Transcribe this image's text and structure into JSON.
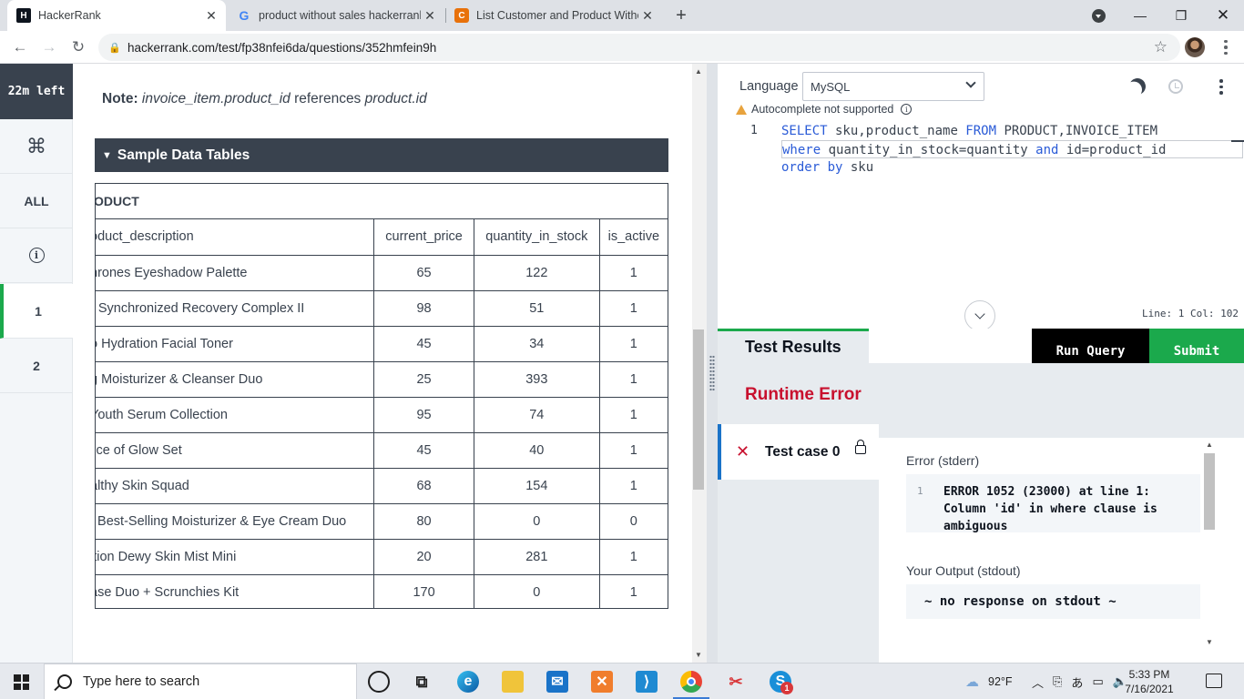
{
  "browser": {
    "tabs": [
      {
        "title": "HackerRank",
        "icon": "hackerrank-icon",
        "active": true
      },
      {
        "title": "product without sales hackerrank",
        "icon": "google-icon",
        "active": false
      },
      {
        "title": "List Customer and Product Witho",
        "icon": "c-logo-icon",
        "active": false
      }
    ],
    "url": "hackerrank.com/test/fp38nfei6da/questions/352hmfein9h"
  },
  "rail": {
    "timer": "22m left",
    "items": [
      "ALL",
      "1",
      "2"
    ]
  },
  "question": {
    "note_label": "Note:",
    "note_ref1": "invoice_item.product_id",
    "note_mid": "references",
    "note_ref2": "product.id",
    "sample_title": "Sample Data Tables",
    "table_title": "ODUCT",
    "columns": [
      "oduct_description",
      "current_price",
      "quantity_in_stock",
      "is_active"
    ],
    "rows": [
      [
        "hrones Eyeshadow Palette",
        "65",
        "122",
        "1"
      ],
      [
        "r Synchronized Recovery Complex II",
        "98",
        "51",
        "1"
      ],
      [
        "o Hydration Facial Toner",
        "45",
        "34",
        "1"
      ],
      [
        "g Moisturizer & Cleanser Duo",
        "25",
        "393",
        "1"
      ],
      [
        "Youth Serum Collection",
        "95",
        "74",
        "1"
      ],
      [
        "lice of Glow Set",
        "45",
        "40",
        "1"
      ],
      [
        "althy Skin Squad",
        "68",
        "154",
        "1"
      ],
      [
        "! Best-Selling Moisturizer & Eye Cream Duo",
        "80",
        "0",
        "0"
      ],
      [
        "ition Dewy Skin Mist Mini",
        "20",
        "281",
        "1"
      ],
      [
        "ase Duo + Scrunchies Kit",
        "170",
        "0",
        "1"
      ]
    ]
  },
  "editor": {
    "language_label": "Language",
    "language_value": "MySQL",
    "autocomplete_note": "Autocomplete not supported",
    "lines": [
      {
        "num": "1",
        "segments": [
          [
            "kw",
            "SELECT"
          ],
          [
            "",
            " sku,product_name "
          ],
          [
            "kw",
            "FROM"
          ],
          [
            "",
            " PRODUCT,INVOICE_ITEM"
          ]
        ]
      },
      {
        "num": "",
        "segments": [
          [
            "kw",
            "where"
          ],
          [
            "",
            " quantity_in_stock=quantity "
          ],
          [
            "kw",
            "and"
          ],
          [
            "",
            " id=product_id"
          ]
        ]
      },
      {
        "num": "",
        "segments": [
          [
            "kw",
            "order"
          ],
          [
            "",
            " "
          ],
          [
            "kw",
            "by"
          ],
          [
            "",
            " sku"
          ]
        ]
      }
    ],
    "status": "Line: 1 Col: 102"
  },
  "results": {
    "tab_label": "Test Results",
    "run_label": "Run Query",
    "submit_label": "Submit",
    "status": "Runtime Error",
    "testcase_label": "Test case 0",
    "stderr_label": "Error (stderr)",
    "stderr_line": "1",
    "stderr_text": "ERROR 1052 (23000) at line 1:\nColumn 'id' in where clause is\nambiguous",
    "stdout_label": "Your Output (stdout)",
    "stdout_text": "~ no response on stdout ~"
  },
  "taskbar": {
    "search_placeholder": "Type here to search",
    "weather": "92°F",
    "time": "5:33 PM",
    "date": "7/16/2021",
    "badge": "1"
  },
  "colors": {
    "accent_green": "#1ba94c",
    "dark_header": "#39424e",
    "error_red": "#c8102e",
    "keyword_blue": "#2a5bd7"
  }
}
